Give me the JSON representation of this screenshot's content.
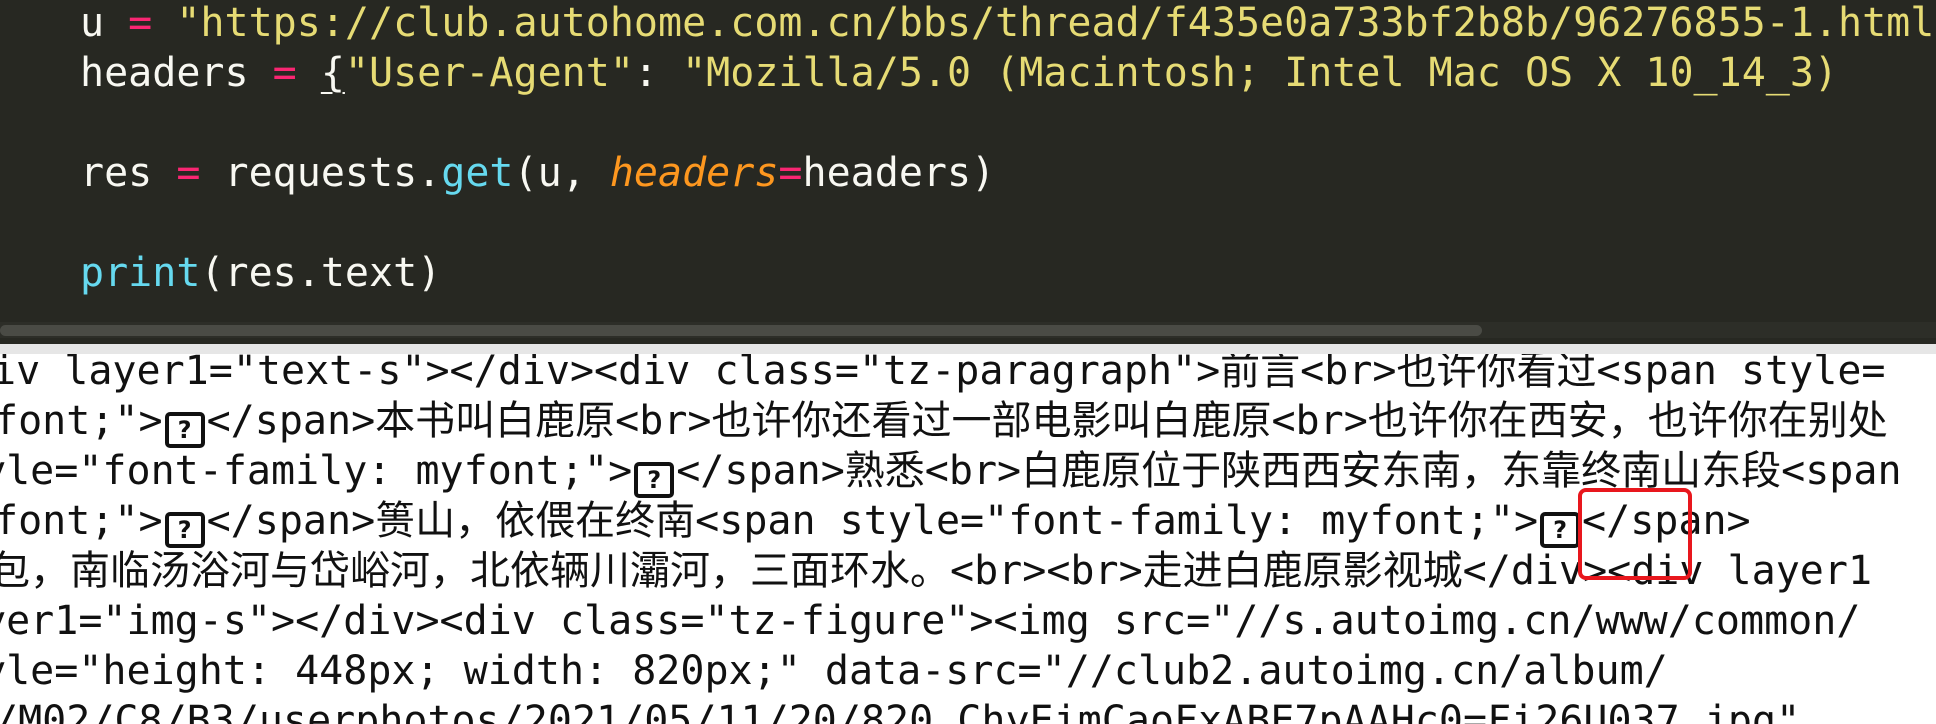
{
  "editor": {
    "line_u": {
      "var": "u",
      "op": " = ",
      "string": "\"https://club.autohome.com.cn/bbs/thread/f435e0a733bf2b8b/96276855-1.html"
    },
    "line_headers": {
      "var": "headers",
      "op": " = ",
      "brace": "{",
      "key": "\"User-Agent\"",
      "colon": ": ",
      "value": "\"Mozilla/5.0 (Macintosh; Intel Mac OS X 10_14_3) "
    },
    "line_res": {
      "var": "res",
      "op": " = ",
      "obj": "requests.",
      "method": "get",
      "open_args": "(u, ",
      "kwarg": "headers",
      "eq": "=",
      "close_args": "headers)"
    },
    "line_print": {
      "fn": "print",
      "args": "(res.text)"
    }
  },
  "output": {
    "glyph": "?",
    "line1": "iv layer1=\"text-s\"></div><div class=\"tz-paragraph\">前言<br>也许你看过<span style=",
    "line2_a": "font;\">",
    "line2_b": "</span>本书叫白鹿原<br>也许你还看过一部电影叫白鹿原<br>也许你在西安，也许你在别处",
    "line3_a": "yle=\"font-family: myfont;\">",
    "line3_b": "</span>熟悉<br>白鹿原位于陕西西安东南，东靠终南山东段<span",
    "line4_a": "font;\">",
    "line4_b": "</span>篑山，依偎在终南<span style=\"font-family: myfont;\">",
    "line4_c": "</span>",
    "line5": "包，南临汤浴河与岱峪河，北依辆川灞河，三面环水。<br><br>走进白鹿原影视城</div><div layer1",
    "line6": "yer1=\"img-s\"></div><div class=\"tz-figure\"><img src=\"//s.autoimg.cn/www/common/",
    "line7": "yle=\"height: 448px; width: 820px;\" data-src=\"//club2.autoimg.cn/album/",
    "line8": "/M02/C8/B3/userphotos/2021/05/11/20/820_ChyEimCaoFxABE7pAAHc0=Fi26U037.jpg\""
  },
  "colors": {
    "editor_bg": "#272822",
    "string": "#e6db74",
    "operator": "#f92672",
    "function": "#66d9ef",
    "param": "#fd971f",
    "highlight": "#e8171d"
  }
}
